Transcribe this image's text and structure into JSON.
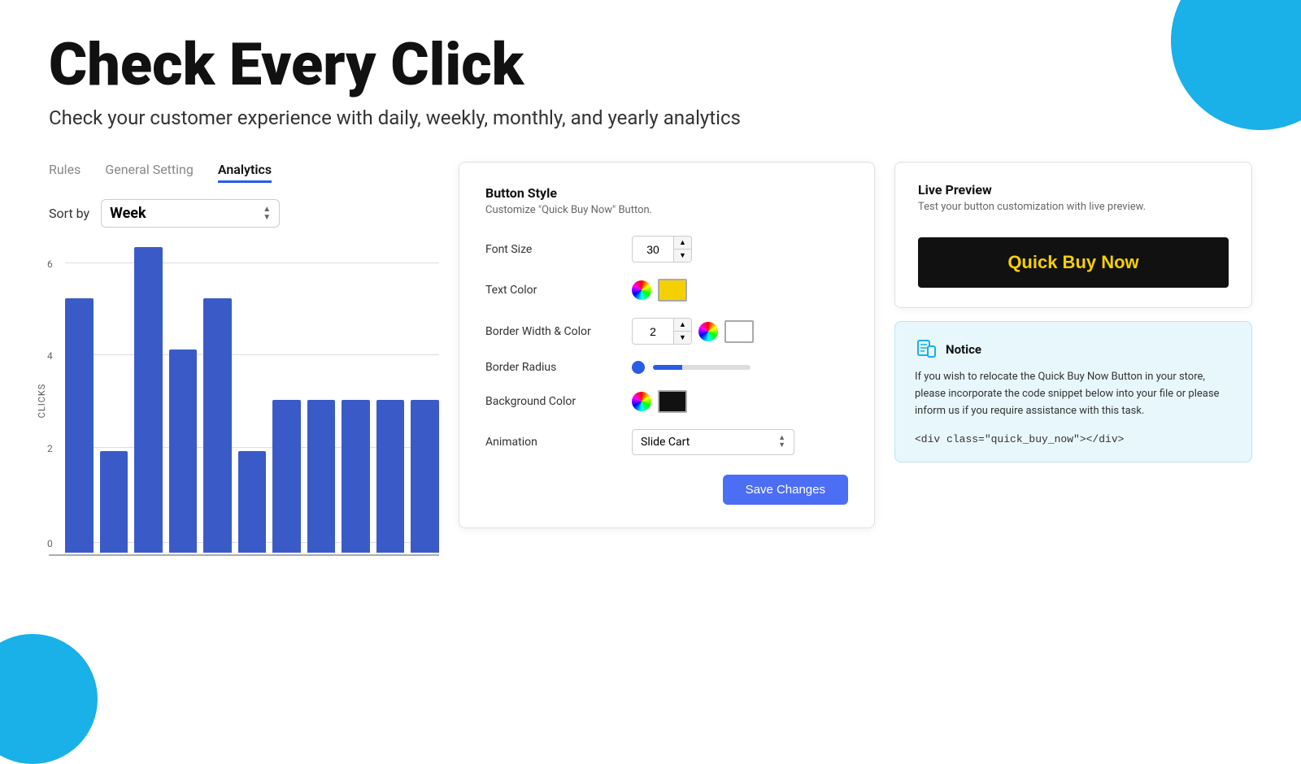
{
  "hero": {
    "title": "Check Every Click",
    "subtitle": "Check your customer experience with daily, weekly, monthly, and yearly analytics"
  },
  "tabs": [
    {
      "id": "rules",
      "label": "Rules",
      "active": false
    },
    {
      "id": "general",
      "label": "General Setting",
      "active": false
    },
    {
      "id": "analytics",
      "label": "Analytics",
      "active": true
    }
  ],
  "sort": {
    "label": "Sort by",
    "value": "Week"
  },
  "chart": {
    "y_label": "CLICKS",
    "y_ticks": [
      6,
      4,
      2,
      0
    ],
    "bars": [
      5,
      2,
      6,
      4,
      5,
      2,
      3,
      3,
      3,
      3,
      3
    ]
  },
  "button_style": {
    "title": "Button Style",
    "description": "Customize \"Quick Buy Now\" Button.",
    "font_size": {
      "label": "Font Size",
      "value": "30"
    },
    "text_color": {
      "label": "Text Color",
      "color": "yellow"
    },
    "border": {
      "label": "Border Width & Color",
      "width": "2"
    },
    "border_radius": {
      "label": "Border Radius"
    },
    "background_color": {
      "label": "Background Color",
      "color": "black"
    },
    "animation": {
      "label": "Animation",
      "value": "Slide Cart"
    },
    "save_button": "Save Changes"
  },
  "live_preview": {
    "title": "Live Preview",
    "description": "Test your button customization with live preview.",
    "button_text": "Quick Buy Now"
  },
  "notice": {
    "title": "Notice",
    "text": "If you wish to relocate the Quick Buy Now Button in your store, please incorporate the code snippet below into your file or please inform us if you require assistance with this task.",
    "code": "<div class=\"quick_buy_now\"></div>"
  }
}
